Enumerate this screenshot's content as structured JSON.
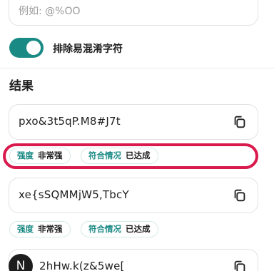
{
  "input": {
    "placeholder": "例如: @%OO"
  },
  "toggle": {
    "label": "排除易混淆字符",
    "on": true
  },
  "results": {
    "title": "结果",
    "items": [
      {
        "password": "pxo&3t5qP.M8#J7t",
        "strength_label": "强度",
        "strength_value": "非常强",
        "compliance_label": "符合情况",
        "compliance_value": "已达成"
      },
      {
        "password": "xe{sSQMMjW5,TbcY",
        "strength_label": "强度",
        "strength_value": "非常强",
        "compliance_label": "符合情况",
        "compliance_value": "已达成"
      },
      {
        "password": "2hHw.k(z&5we["
      }
    ]
  },
  "avatar": {
    "letter": "N"
  },
  "colors": {
    "accent": "#1a8a85",
    "highlight": "#d81b4c"
  },
  "icons": {
    "copy": "copy-icon"
  }
}
